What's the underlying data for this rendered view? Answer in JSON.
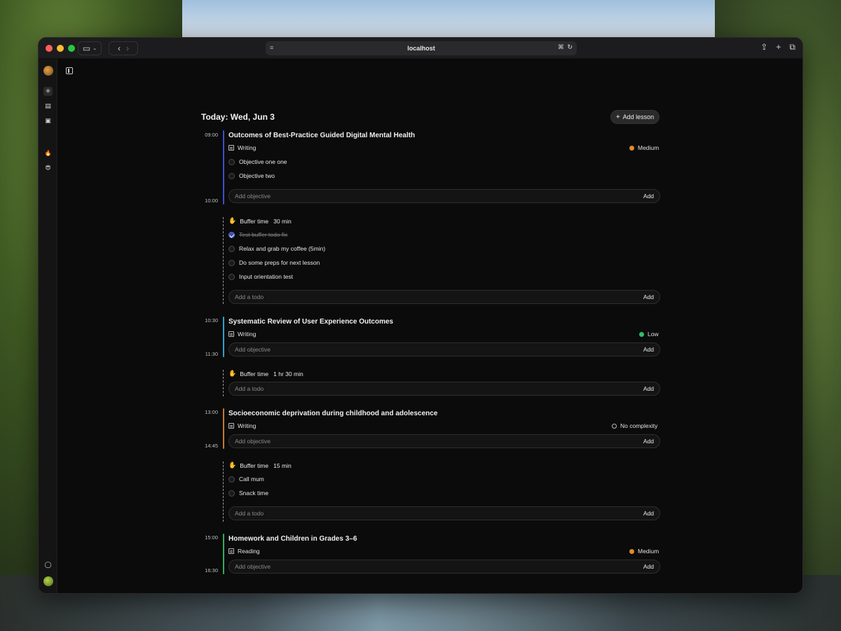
{
  "browser": {
    "url": "localhost"
  },
  "header": {
    "title": "Today: Wed, Jun 3",
    "add_lesson_label": "Add lesson"
  },
  "colors": {
    "lesson1_bar": "#3b4fd1",
    "lesson2_bar": "#2aa3c9",
    "lesson3_bar": "#c47a2a",
    "lesson4_bar": "#2fae5a",
    "complexity_medium": "#e0892e",
    "complexity_low": "#2fbf6a"
  },
  "lessons": [
    {
      "start": "09:00",
      "end": "10:00",
      "title": "Outcomes of Best-Practice Guided Digital Mental Health",
      "type": "Writing",
      "complexity": "Medium",
      "objectives": [
        "Objective one one",
        "Objective two"
      ],
      "input_placeholder": "Add objective",
      "add_label": "Add"
    },
    {
      "start": "10:30",
      "end": "11:30",
      "title": "Systematic Review of User Experience Outcomes",
      "type": "Writing",
      "complexity": "Low",
      "objectives": [],
      "input_placeholder": "Add objective",
      "add_label": "Add"
    },
    {
      "start": "13:00",
      "end": "14:45",
      "title": "Socioeconomic deprivation during childhood and adolescence",
      "type": "Writing",
      "complexity": "No complexity",
      "objectives": [],
      "input_placeholder": "Add objective",
      "add_label": "Add"
    },
    {
      "start": "15:00",
      "end": "16:30",
      "title": "Homework and Children in Grades 3–6",
      "type": "Reading",
      "complexity": "Medium",
      "objectives": [],
      "input_placeholder": "Add objective",
      "add_label": "Add"
    }
  ],
  "buffers": [
    {
      "label": "Buffer time",
      "duration": "30 min",
      "todos": [
        {
          "text": "Test buffer todo fix",
          "done": true
        },
        {
          "text": "Relax and grab my coffee (5min)",
          "done": false
        },
        {
          "text": "Do some preps for next lesson",
          "done": false
        },
        {
          "text": "Input orientation test",
          "done": false
        }
      ],
      "input_placeholder": "Add a todo",
      "add_label": "Add"
    },
    {
      "label": "Buffer time",
      "duration": "1 hr 30 min",
      "todos": [],
      "input_placeholder": "Add a todo",
      "add_label": "Add"
    },
    {
      "label": "Buffer time",
      "duration": "15 min",
      "todos": [
        {
          "text": "Call mum",
          "done": false
        },
        {
          "text": "Snack time",
          "done": false
        }
      ],
      "input_placeholder": "Add a todo",
      "add_label": "Add"
    }
  ]
}
